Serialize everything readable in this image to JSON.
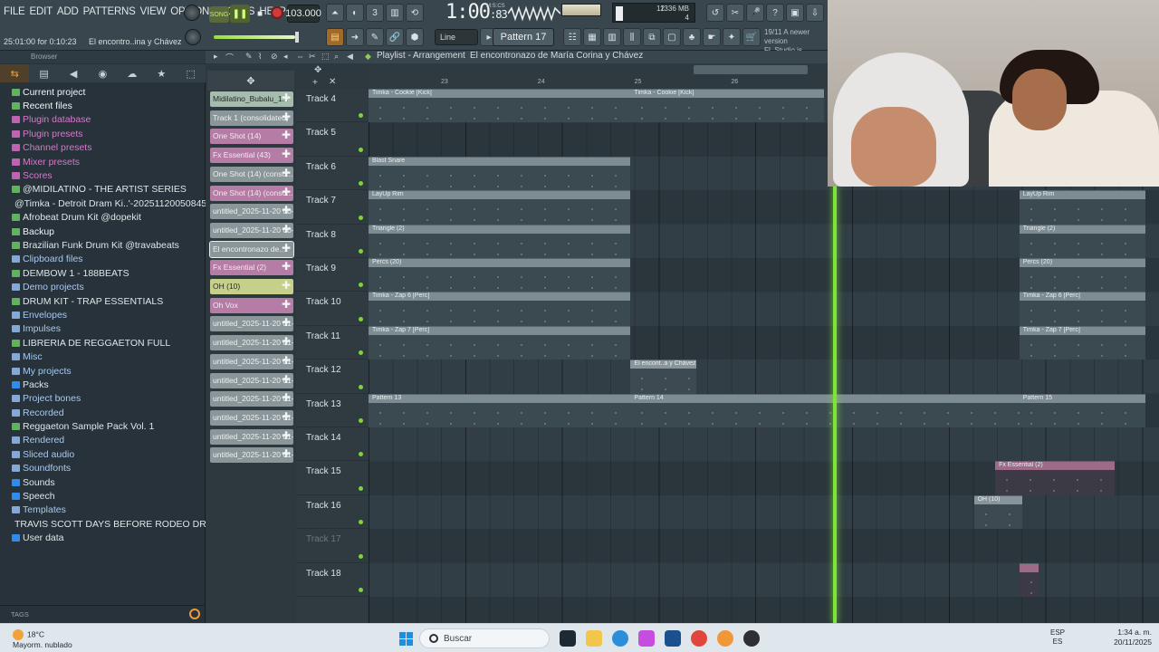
{
  "menu": [
    "FILE",
    "EDIT",
    "ADD",
    "PATTERNS",
    "VIEW",
    "OPTIONS",
    "TOOLS",
    "HELP"
  ],
  "hint": {
    "position": "25:01:00 for 0:10:23",
    "project": "El encontro..ina y Chávez"
  },
  "transport": {
    "song_label": "SONG",
    "tempo": "103.000",
    "time_main": "1:00",
    "time_sub": "83",
    "time_unit": "M:S:CS"
  },
  "cpu": {
    "memory": "1336 MB",
    "value1": "12",
    "value2": "4"
  },
  "toolbar": {
    "snap": "Line",
    "pattern": "Pattern 17"
  },
  "news": {
    "line1": "19/11  A newer version",
    "line2": "FL Studio is available!"
  },
  "browser": {
    "title": "Browser",
    "items": [
      {
        "label": "Current project",
        "style": "sel"
      },
      {
        "label": "Recent files",
        "style": "sel"
      },
      {
        "label": "Plugin database",
        "style": "pink"
      },
      {
        "label": "Plugin presets",
        "style": "pink"
      },
      {
        "label": "Channel presets",
        "style": "pink"
      },
      {
        "label": "Mixer presets",
        "style": "pink"
      },
      {
        "label": "Scores",
        "style": "pink"
      },
      {
        "label": "@MIDILATINO - THE ARTIST SERIES",
        "style": "green"
      },
      {
        "label": "@Timka - Detroit Dram Ki..'-202511200508452-1-001",
        "style": "green"
      },
      {
        "label": "Afrobeat Drum Kit @dopekit",
        "style": "green"
      },
      {
        "label": "Backup",
        "style": "sel"
      },
      {
        "label": "Brazilian Funk Drum Kit @travabeats",
        "style": "green"
      },
      {
        "label": "Clipboard files",
        "style": "blue"
      },
      {
        "label": "DEMBOW 1 - 188BEATS",
        "style": "green"
      },
      {
        "label": "Demo projects",
        "style": "blue"
      },
      {
        "label": "DRUM KIT - TRAP ESSENTIALS",
        "style": "green"
      },
      {
        "label": "Envelopes",
        "style": "blue"
      },
      {
        "label": "Impulses",
        "style": "blue"
      },
      {
        "label": "LIBRERIA DE REGGAETON FULL",
        "style": "green"
      },
      {
        "label": "Misc",
        "style": "blue"
      },
      {
        "label": "My projects",
        "style": "blue"
      },
      {
        "label": "Packs",
        "style": "hl"
      },
      {
        "label": "Project bones",
        "style": "blue"
      },
      {
        "label": "Recorded",
        "style": "blue"
      },
      {
        "label": "Reggaeton Sample Pack Vol. 1",
        "style": "green"
      },
      {
        "label": "Rendered",
        "style": "blue"
      },
      {
        "label": "Sliced audio",
        "style": "blue"
      },
      {
        "label": "Soundfonts",
        "style": "blue"
      },
      {
        "label": "Sounds",
        "style": "hl"
      },
      {
        "label": "Speech",
        "style": "hl"
      },
      {
        "label": "Templates",
        "style": "blue"
      },
      {
        "label": "TRAVIS SCOTT DAYS BEFORE RODEO DRUM KIT dopekit",
        "style": "green"
      },
      {
        "label": "User data",
        "style": "hl"
      }
    ],
    "tags_label": "TAGS"
  },
  "picker": [
    {
      "label": "Midilatino_Bubalu_1...",
      "style": "g"
    },
    {
      "label": "Track 1 (consolidated)",
      "style": "gy"
    },
    {
      "label": "One Shot (14)",
      "style": "p"
    },
    {
      "label": "Fx Essential (43)",
      "style": "p"
    },
    {
      "label": "One Shot (14) (conso...",
      "style": "gy"
    },
    {
      "label": "One Shot (14) (conso...",
      "style": "p"
    },
    {
      "label": "untitled_2025-11-20 00-...",
      "style": "gy"
    },
    {
      "label": "untitled_2025-11-20 00-...",
      "style": "gy"
    },
    {
      "label": "El encontronazo de...",
      "style": "gy",
      "sel": true
    },
    {
      "label": "Fx Essential (2)",
      "style": "p"
    },
    {
      "label": "OH (10)",
      "style": "y"
    },
    {
      "label": "Oh Vox",
      "style": "p"
    },
    {
      "label": "untitled_2025-11-20 01-...",
      "style": "gy"
    },
    {
      "label": "untitled_2025-11-20 01-...",
      "style": "gy"
    },
    {
      "label": "untitled_2025-11-20 01-...",
      "style": "gy"
    },
    {
      "label": "untitled_2025-11-20 01-...",
      "style": "gy"
    },
    {
      "label": "untitled_2025-11-20 01-...",
      "style": "gy"
    },
    {
      "label": "untitled_2025-11-20 01-...",
      "style": "gy"
    },
    {
      "label": "untitled_2025-11-20 01-...",
      "style": "gy"
    },
    {
      "label": "untitled_2025-11-20 01-...",
      "style": "gy"
    }
  ],
  "playlist": {
    "title": "Playlist - Arrangement",
    "project": "El encontronazo de María Corina y Chávez",
    "bars": [
      "23",
      "24",
      "25",
      "26"
    ],
    "tracks": [
      "Track 4",
      "Track 5",
      "Track 6",
      "Track 7",
      "Track 8",
      "Track 9",
      "Track 10",
      "Track 11",
      "Track 12",
      "Track 13",
      "Track 14",
      "Track 15",
      "Track 16",
      "Track 17",
      "Track 18"
    ],
    "clips": [
      {
        "row": 0,
        "start": 0,
        "len": 2.71,
        "label": "Timka - Cookie [Kick]",
        "style": "lite"
      },
      {
        "row": 0,
        "start": 2.71,
        "len": 2.0,
        "label": "Timka - Cookie [Kick]",
        "style": "lite"
      },
      {
        "row": 2,
        "start": 0,
        "len": 2.71,
        "label": "Blast Snare",
        "style": "lite"
      },
      {
        "row": 3,
        "start": 0,
        "len": 2.71,
        "label": "LayUp Rim",
        "style": "lite"
      },
      {
        "row": 3,
        "start": 6.73,
        "len": 1.3,
        "label": "LayUp Rim",
        "style": "lite"
      },
      {
        "row": 4,
        "start": 0,
        "len": 2.71,
        "label": "Triangle (2)",
        "style": "lite"
      },
      {
        "row": 4,
        "start": 6.73,
        "len": 1.3,
        "label": "Triangle (2)",
        "style": "lite"
      },
      {
        "row": 5,
        "start": 0,
        "len": 2.71,
        "label": "Percs (20)",
        "style": "lite"
      },
      {
        "row": 5,
        "start": 6.73,
        "len": 1.3,
        "label": "Percs (20)",
        "style": "lite"
      },
      {
        "row": 6,
        "start": 0,
        "len": 2.71,
        "label": "Timka - Zap 6 [Perc]",
        "style": "lite"
      },
      {
        "row": 6,
        "start": 6.73,
        "len": 1.3,
        "label": "Timka - Zap 6 [Perc]",
        "style": "lite"
      },
      {
        "row": 7,
        "start": 0,
        "len": 2.71,
        "label": "Timka - Zap 7 [Perc]",
        "style": "lite"
      },
      {
        "row": 7,
        "start": 6.73,
        "len": 1.3,
        "label": "Timka - Zap 7 [Perc]",
        "style": "lite"
      },
      {
        "row": 8,
        "start": 2.71,
        "len": 0.68,
        "label": "El encont..a y Chávez",
        "style": "sm"
      },
      {
        "row": 9,
        "start": 0,
        "len": 2.71,
        "label": "Pattern 13",
        "style": "lite"
      },
      {
        "row": 9,
        "start": 2.71,
        "len": 4.02,
        "label": "Pattern 14",
        "style": "lite"
      },
      {
        "row": 9,
        "start": 6.73,
        "len": 1.3,
        "label": "Pattern 15",
        "style": "lite"
      },
      {
        "row": 11,
        "start": 6.48,
        "len": 1.24,
        "label": "Fx Essential (2)",
        "style": "pink"
      },
      {
        "row": 12,
        "start": 6.26,
        "len": 0.5,
        "label": "OH (10)",
        "style": "sm"
      },
      {
        "row": 14,
        "start": 6.73,
        "len": 0.2,
        "label": "",
        "style": "pink"
      }
    ]
  },
  "taskbar": {
    "temp": "18°C",
    "weather": "Mayorm. nublado",
    "search": "Buscar",
    "lang1": "ESP",
    "lang2": "ES",
    "clock": "1:34 a. m.",
    "date": "20/11/2025"
  },
  "colors": {
    "accent": "#7ee43a",
    "browser_bg": "#27323a",
    "playlist_bg": "#2b363c"
  }
}
